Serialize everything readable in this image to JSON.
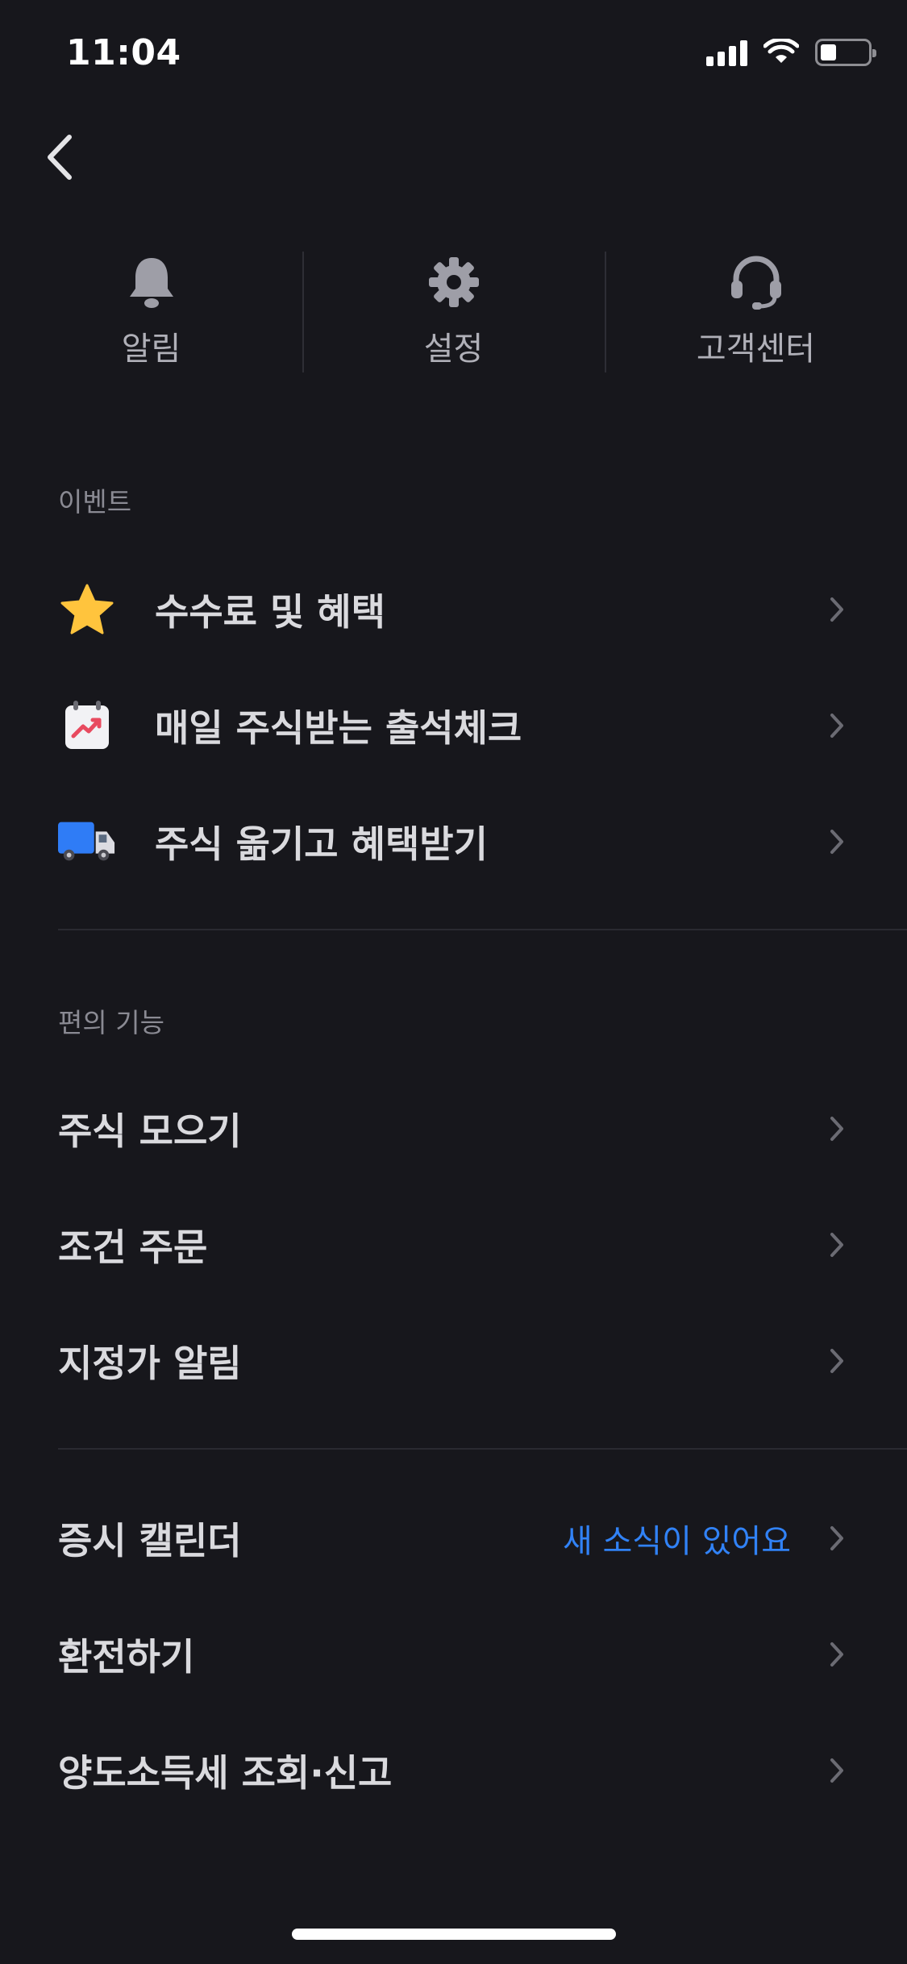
{
  "status_bar": {
    "time": "11:04"
  },
  "quick_menu": {
    "items": [
      {
        "label": "알림",
        "icon": "bell-icon"
      },
      {
        "label": "설정",
        "icon": "gear-icon"
      },
      {
        "label": "고객센터",
        "icon": "headset-icon"
      }
    ]
  },
  "events": {
    "header": "이벤트",
    "items": [
      {
        "label": "수수료 및 혜택",
        "icon": "star-icon"
      },
      {
        "label": "매일 주식받는 출석체크",
        "icon": "calendar-chart-icon"
      },
      {
        "label": "주식 옮기고 혜택받기",
        "icon": "truck-icon"
      }
    ]
  },
  "convenience": {
    "header": "편의 기능",
    "items": [
      {
        "label": "주식 모으기"
      },
      {
        "label": "조건 주문"
      },
      {
        "label": "지정가 알림"
      }
    ]
  },
  "more": {
    "items": [
      {
        "label": "증시 캘린더",
        "badge": "새 소식이 있어요"
      },
      {
        "label": "환전하기"
      },
      {
        "label": "양도소득세 조회·신고"
      }
    ]
  },
  "colors": {
    "background": "#17171c",
    "accent": "#3182f6",
    "star": "#ffc43d",
    "truck": "#2f7cf6"
  }
}
